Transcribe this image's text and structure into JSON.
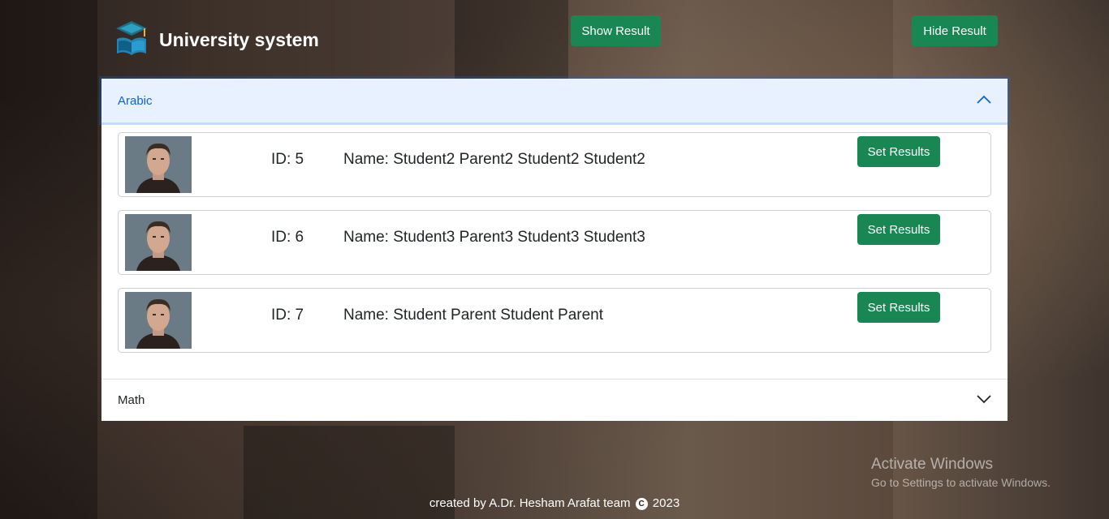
{
  "brand": {
    "name": "University system",
    "logo_icon": "graduation-books-logo-icon"
  },
  "header": {
    "show_result_label": "Show Result",
    "hide_result_label": "Hide Result"
  },
  "accordion": {
    "sections": [
      {
        "title": "Arabic",
        "expanded": true,
        "chevron_icon": "chevron-up-icon",
        "students": [
          {
            "id_text": "ID: 5",
            "name_text": "Name: Student2 Parent2 Student2 Student2",
            "button_label": "Set Results"
          },
          {
            "id_text": "ID: 6",
            "name_text": "Name: Student3 Parent3 Student3 Student3",
            "button_label": "Set Results"
          },
          {
            "id_text": "ID: 7",
            "name_text": "Name: Student Parent Student Parent",
            "button_label": "Set Results"
          }
        ]
      },
      {
        "title": "Math",
        "expanded": false,
        "chevron_icon": "chevron-down-icon"
      }
    ]
  },
  "watermark": {
    "title": "Activate Windows",
    "subtitle": "Go to Settings to activate Windows."
  },
  "footer": {
    "prefix": "created by A.Dr. Hesham Arafat team",
    "copyright_symbol": "C",
    "year": "2023"
  },
  "colors": {
    "primary_button": "#198754",
    "accordion_active_bg": "#e7f1ff",
    "accordion_active_text": "#0c63e4"
  }
}
